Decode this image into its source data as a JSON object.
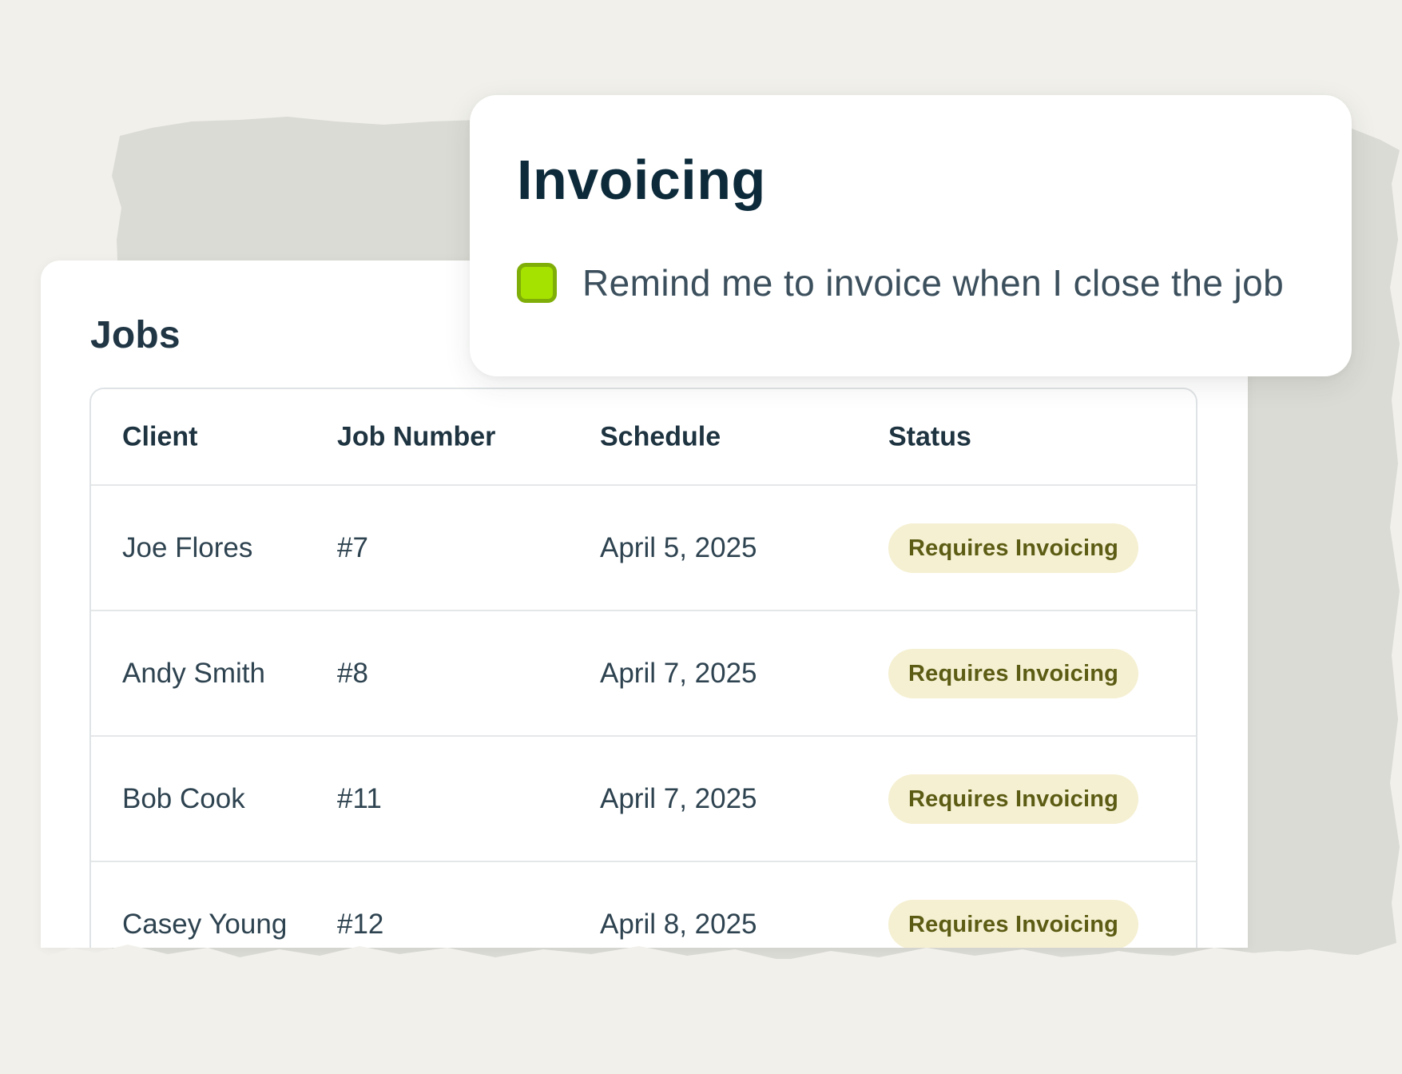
{
  "invoicing": {
    "title": "Invoicing",
    "reminder_label": "Remind me to invoice when I close the job",
    "reminder_checked": true
  },
  "jobs": {
    "title": "Jobs",
    "columns": [
      "Client",
      "Job Number",
      "Schedule",
      "Status"
    ],
    "rows": [
      {
        "client": "Joe Flores",
        "job_number": "#7",
        "schedule": "April 5, 2025",
        "status": "Requires Invoicing"
      },
      {
        "client": "Andy Smith",
        "job_number": "#8",
        "schedule": "April 7, 2025",
        "status": "Requires Invoicing"
      },
      {
        "client": "Bob Cook",
        "job_number": "#11",
        "schedule": "April 7, 2025",
        "status": "Requires Invoicing"
      },
      {
        "client": "Casey Young",
        "job_number": "#12",
        "schedule": "April 8, 2025",
        "status": "Requires Invoicing"
      }
    ]
  },
  "colors": {
    "background": "#f1f0eb",
    "torn_paper": "#dbdbd5",
    "card": "#ffffff",
    "title_text": "#0c2a3a",
    "checkbox_fill": "#a6e200",
    "checkbox_border": "#7fae08",
    "badge_bg": "#f5f0d2",
    "badge_text": "#5c5c14"
  }
}
